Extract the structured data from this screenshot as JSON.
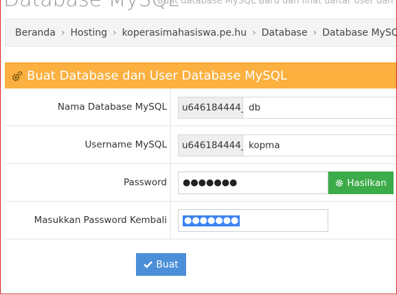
{
  "page": {
    "heading": "Database MySQL",
    "subheading": "Buat database MySQL Baru dan lihat daftar user dan Da"
  },
  "breadcrumb": [
    "Beranda",
    "Hosting",
    "koperasimahasiswa.pe.hu",
    "Database",
    "Database MySQL"
  ],
  "panel": {
    "title": "Buat Database dan User Database MySQL"
  },
  "form": {
    "db_name": {
      "label": "Nama Database MySQL",
      "prefix": "u646184444_",
      "value": "db"
    },
    "username": {
      "label": "Username MySQL",
      "prefix": "u646184444_",
      "value": "kopma"
    },
    "password": {
      "label": "Password",
      "value": "●●●●●●●",
      "generate_label": "Hasilkan"
    },
    "password_confirm": {
      "label": "Masukkan Password Kembali",
      "value": "●●●●●●●"
    },
    "submit_label": "Buat"
  },
  "colors": {
    "panel_header": "#fbb040",
    "generate_button": "#3cab49",
    "submit_button": "#4a8fd8",
    "window_border": "#d81f1f"
  },
  "icons": {
    "breadcrumb_home": "home-icon",
    "panel": "gears-icon",
    "generate": "gear-icon",
    "submit": "check-icon"
  }
}
